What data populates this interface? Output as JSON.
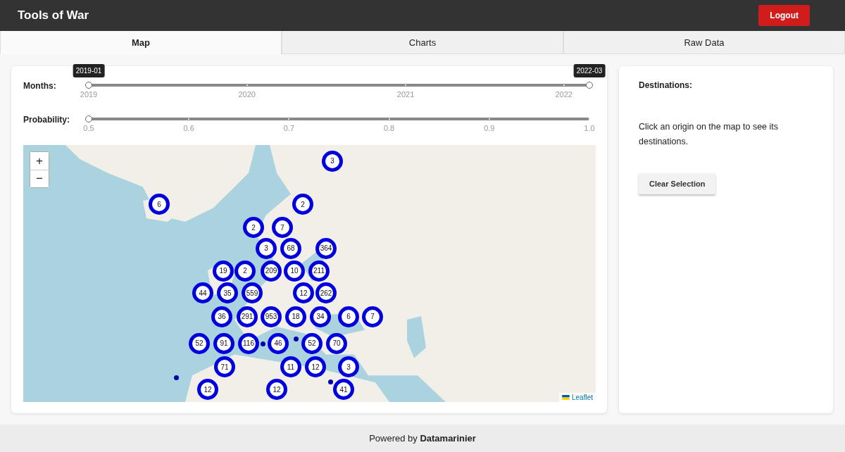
{
  "header": {
    "title": "Tools of War",
    "logout": "Logout"
  },
  "tabs": [
    {
      "label": "Map",
      "selected": true
    },
    {
      "label": "Charts",
      "selected": false
    },
    {
      "label": "Raw Data",
      "selected": false
    }
  ],
  "filters": [
    {
      "label": "Months:",
      "ticks": [
        "2019",
        "2020",
        "2021",
        "2022"
      ],
      "handles": [
        {
          "level": 0,
          "tooltip": "2019-01"
        },
        {
          "level": 1,
          "tooltip": "2022-03"
        }
      ]
    },
    {
      "label": "Probability:",
      "ticks": [
        "0.5",
        "0.6",
        "0.7",
        "0.8",
        "0.9",
        "1.0"
      ],
      "handles": [
        {
          "level": 0
        }
      ]
    }
  ],
  "map": {
    "zoom_in": "+",
    "zoom_out": "−",
    "attribution": "Leaflet",
    "clusters": [
      "3",
      "6",
      "2",
      "2",
      "7",
      "3",
      "68",
      "364",
      "19",
      "2",
      "209",
      "10",
      "211",
      "44",
      "35",
      "559",
      "12",
      "262",
      "36",
      "291",
      "953",
      "18",
      "34",
      "6",
      "7",
      "52",
      "91",
      "116",
      "46",
      "52",
      "70",
      "71",
      "11",
      "12",
      "3",
      "12",
      "12",
      "41"
    ]
  },
  "destinations": {
    "title": "Destinations:",
    "hint": "Click an origin on the map to see its destinations.",
    "clear": "Clear Selection"
  },
  "footer": "Powered by **Datamarinier**"
}
